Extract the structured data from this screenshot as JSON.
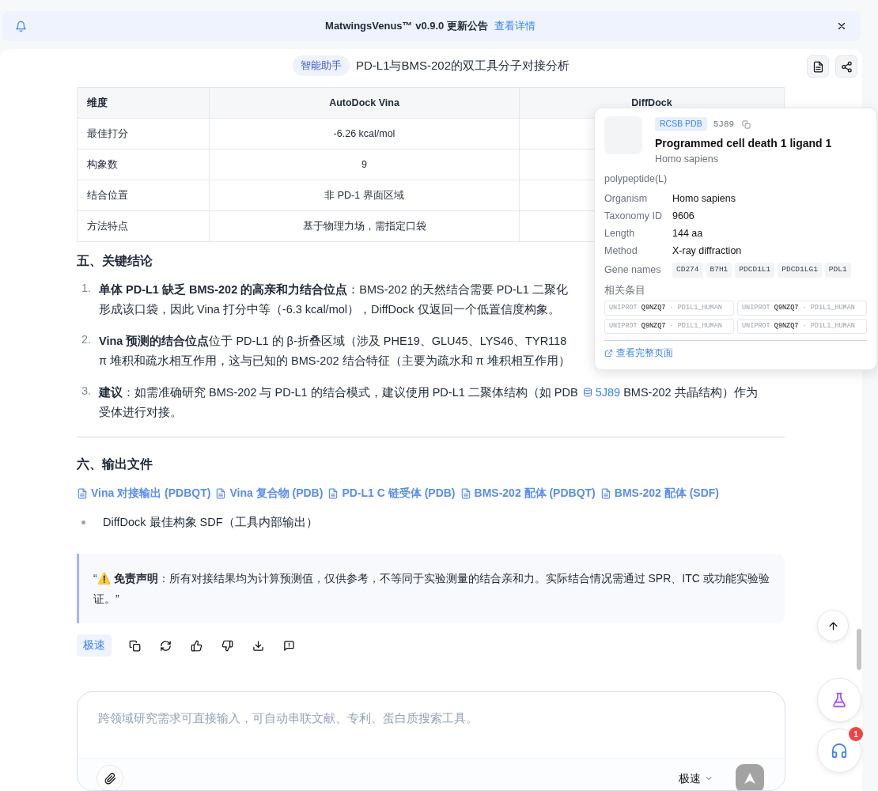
{
  "banner": {
    "title": "MatwingsVenus™ v0.9.0 更新公告",
    "link": "查看详情"
  },
  "header": {
    "tag": "智能助手",
    "title": "PD-L1与BMS-202的双工具分子对接分析"
  },
  "table": {
    "columns": [
      "维度",
      "AutoDock Vina",
      "DiffDock"
    ],
    "rows": [
      [
        "最佳打分",
        "-6.26 kcal/mol"
      ],
      [
        "构象数",
        "9"
      ],
      [
        "结合位置",
        "非 PD-1 界面区域"
      ],
      [
        "方法特点",
        "基于物理力场，需指定口袋"
      ]
    ]
  },
  "conclusions": {
    "heading": "五、关键结论",
    "items": [
      {
        "number": "1.",
        "lines": [
          "**单体 PD-L1 缺乏 BMS-202 的高亲和力结合位点**：BMS-202 的天然结合需要 PD-L1 二聚化",
          "形成该口袋，因此 Vina 打分中等（-6.3 kcal/mol），DiffDock 仅返回一个低置信度构象。"
        ]
      },
      {
        "number": "2.",
        "lines": [
          "**Vina 预测的结合位点**位于 PD-L1 的 β-折叠区域（涉及 PHE19、GLU45、LYS46、TYR118",
          "π 堆积和疏水相互作用，这与已知的 BMS-202 结合特征（主要为疏水和 π 堆积相互作用）"
        ]
      },
      {
        "number": "3.",
        "lines": [
          "**建议**：如需准确研究 BMS-202 与 PD-L1 的结合模式，建议使用 PD-L1 二聚体结构（如 PDB",
          "受体进行对接。"
        ],
        "link": "5J89",
        "after_link": "BMS-202 共晶结构）作为"
      }
    ]
  },
  "outputs": {
    "heading": "六、输出文件",
    "files": [
      "Vina 对接输出 (PDBQT)",
      "Vina 复合物 (PDB)",
      "PD-L1 C 链受体 (PDB)",
      "BMS-202 配体 (PDBQT)",
      "BMS-202 配体 (SDF)"
    ],
    "bullets": [
      "DiffDock 最佳构象 SDF（工具内部输出）"
    ]
  },
  "disclaimer": "“⚠️ **免责声明**：所有对接结果均为计算预测值，仅供参考，不等同于实验测量的结合亲和力。实际结合情况需通过 SPR、ITC 或功能实验验证。”",
  "actions": {
    "mode": "极速"
  },
  "popover": {
    "source": "RCSB PDB",
    "id": "5J89",
    "title": "Programmed cell death 1 ligand 1",
    "species": "Homo sapiens",
    "type": "polypeptide(L)",
    "fields": [
      {
        "label": "Organism",
        "value": "Homo sapiens"
      },
      {
        "label": "Taxonomy ID",
        "value": "9606"
      },
      {
        "label": "Length",
        "value": "144 aa"
      },
      {
        "label": "Method",
        "value": "X-ray diffraction"
      }
    ],
    "gene_label": "Gene names",
    "genes": [
      "CD274",
      "B7H1",
      "PDCD1L1",
      "PDCD1LG1",
      "PDL1"
    ],
    "related_label": "相关条目",
    "related": [
      {
        "db": "UNIPROT",
        "acc": "Q9NZQ7",
        "name": "· PD1L1_HUMAN"
      },
      {
        "db": "UNIPROT",
        "acc": "Q9NZQ7",
        "name": "· PD1L1_HUMAN"
      },
      {
        "db": "UNIPROT",
        "acc": "Q9NZQ7",
        "name": "· PD1L1_HUMAN"
      },
      {
        "db": "UNIPROT",
        "acc": "Q9NZQ7",
        "name": "· PD1L1_HUMAN"
      }
    ],
    "link": "查看完整页面"
  },
  "composer": {
    "placeholder": "跨领域研究需求可直接输入，可自动串联文献、专利、蛋白质搜索工具。",
    "mode": "极速"
  },
  "support": {
    "badge": "1"
  }
}
